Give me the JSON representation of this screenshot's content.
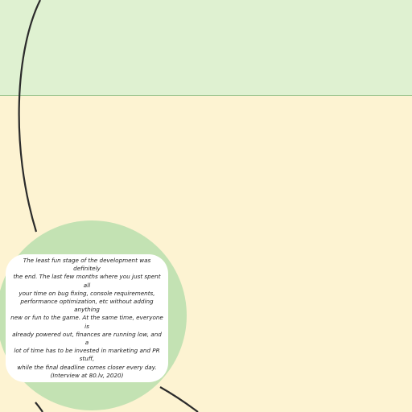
{
  "colors": {
    "background": "#fdf3d2",
    "top_band": "#dff1d1",
    "divider": "#8fbf86",
    "circle_fill": "#c3e2b3",
    "curve": "#2b2b2b",
    "card": "#ffffff",
    "text": "#222222"
  },
  "quote": {
    "text": "The least fun stage of the development was definitely\nthe end. The last few months where you just spent all\nyour time on bug fixing, console  requirements,\nperformance optimization, etc without adding anything\nnew  or fun to the game. At the same time, everyone is\nalready powered out,  finances are running low, and a\nlot of time has to be invested in  marketing and PR stuff,\nwhile the final deadline comes closer every day.\n(Interview at 80.lv, 2020)"
  }
}
